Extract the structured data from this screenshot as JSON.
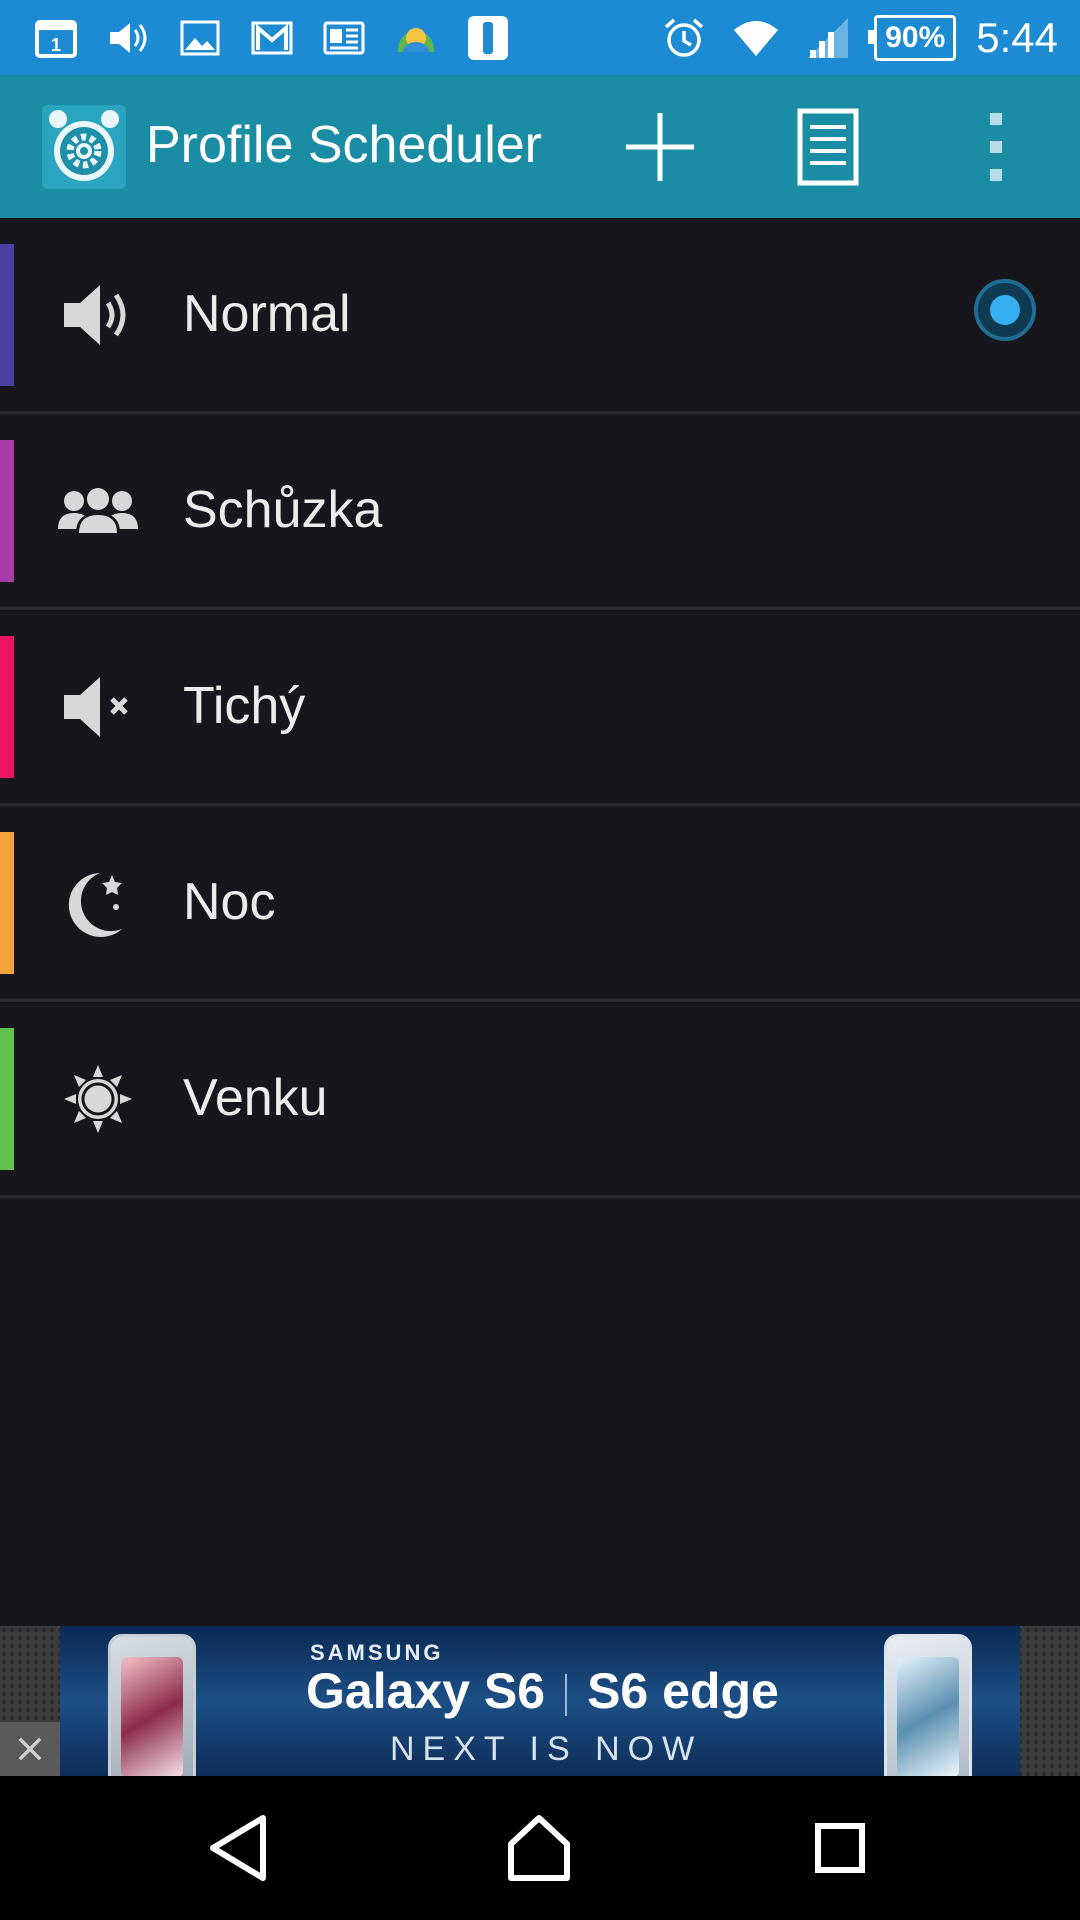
{
  "status_bar": {
    "left_icons": [
      "calendar-icon",
      "volume-icon",
      "gallery-icon",
      "gmail-icon",
      "news-icon",
      "weather-icon",
      "notification-app-icon"
    ],
    "right_icons": [
      "alarm-icon",
      "wifi-icon",
      "signal-icon"
    ],
    "battery": "90%",
    "time": "5:44"
  },
  "app_bar": {
    "title": "Profile Scheduler",
    "logo": "alarm-clock-gear-icon",
    "actions": [
      "add-icon",
      "list-icon",
      "overflow-menu-icon"
    ]
  },
  "profiles": [
    {
      "label": "Normal",
      "icon": "volume-icon",
      "color": "#4b3fa3",
      "active": true
    },
    {
      "label": "Schůzka",
      "icon": "meeting-icon",
      "color": "#a93ba4",
      "active": false
    },
    {
      "label": "Tichý",
      "icon": "mute-icon",
      "color": "#ed1463",
      "active": false
    },
    {
      "label": "Noc",
      "icon": "moon-stars-icon",
      "color": "#f6a33d",
      "active": false
    },
    {
      "label": "Venku",
      "icon": "sun-icon",
      "color": "#63c24e",
      "active": false
    }
  ],
  "ad": {
    "brand": "SAMSUNG",
    "headline_left": "Galaxy S6",
    "headline_right": "S6 edge",
    "tagline": "NEXT IS NOW"
  },
  "nav_bar": [
    "back-icon",
    "home-icon",
    "recents-icon"
  ],
  "colors": {
    "status_bar": "#1c8bd3",
    "app_bar": "#1a8ca3",
    "background": "#17161c",
    "radio_accent": "#35aff0"
  }
}
